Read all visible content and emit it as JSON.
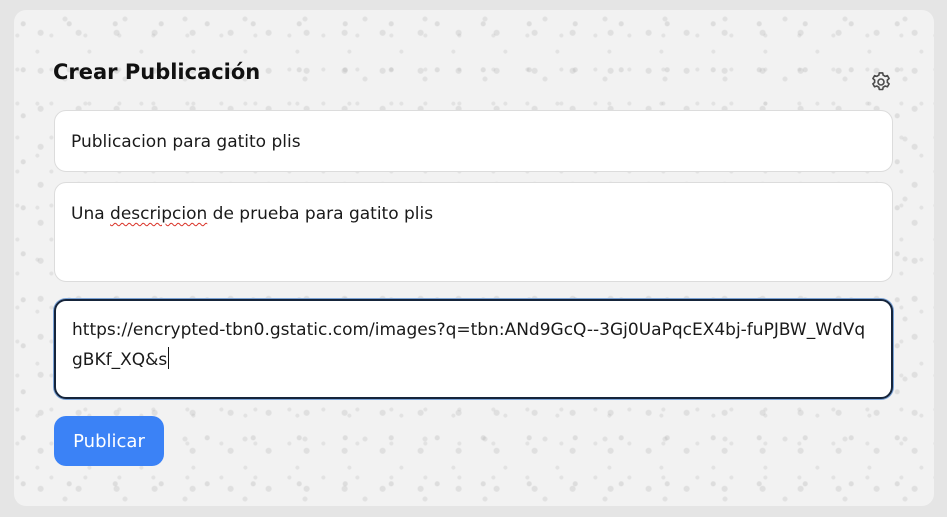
{
  "form": {
    "heading": "Crear Publicación",
    "settings_icon": "gear-icon",
    "title_field": {
      "value": "Publicacion para gatito plis"
    },
    "description_field": {
      "misspelled_word": "descripcion",
      "before": "Una ",
      "after": " de prueba para gatito plis"
    },
    "image_url_field": {
      "value": "https://encrypted-tbn0.gstatic.com/images?q=tbn:ANd9GcQ--3Gj0UaPqcEX4bj-fuPJBW_WdVqgBKf_XQ&s",
      "focused": true
    },
    "submit_label": "Publicar"
  },
  "colors": {
    "accent": "#3b82f6",
    "focus_border": "#15243a",
    "card_background": "#f2f2f2"
  }
}
